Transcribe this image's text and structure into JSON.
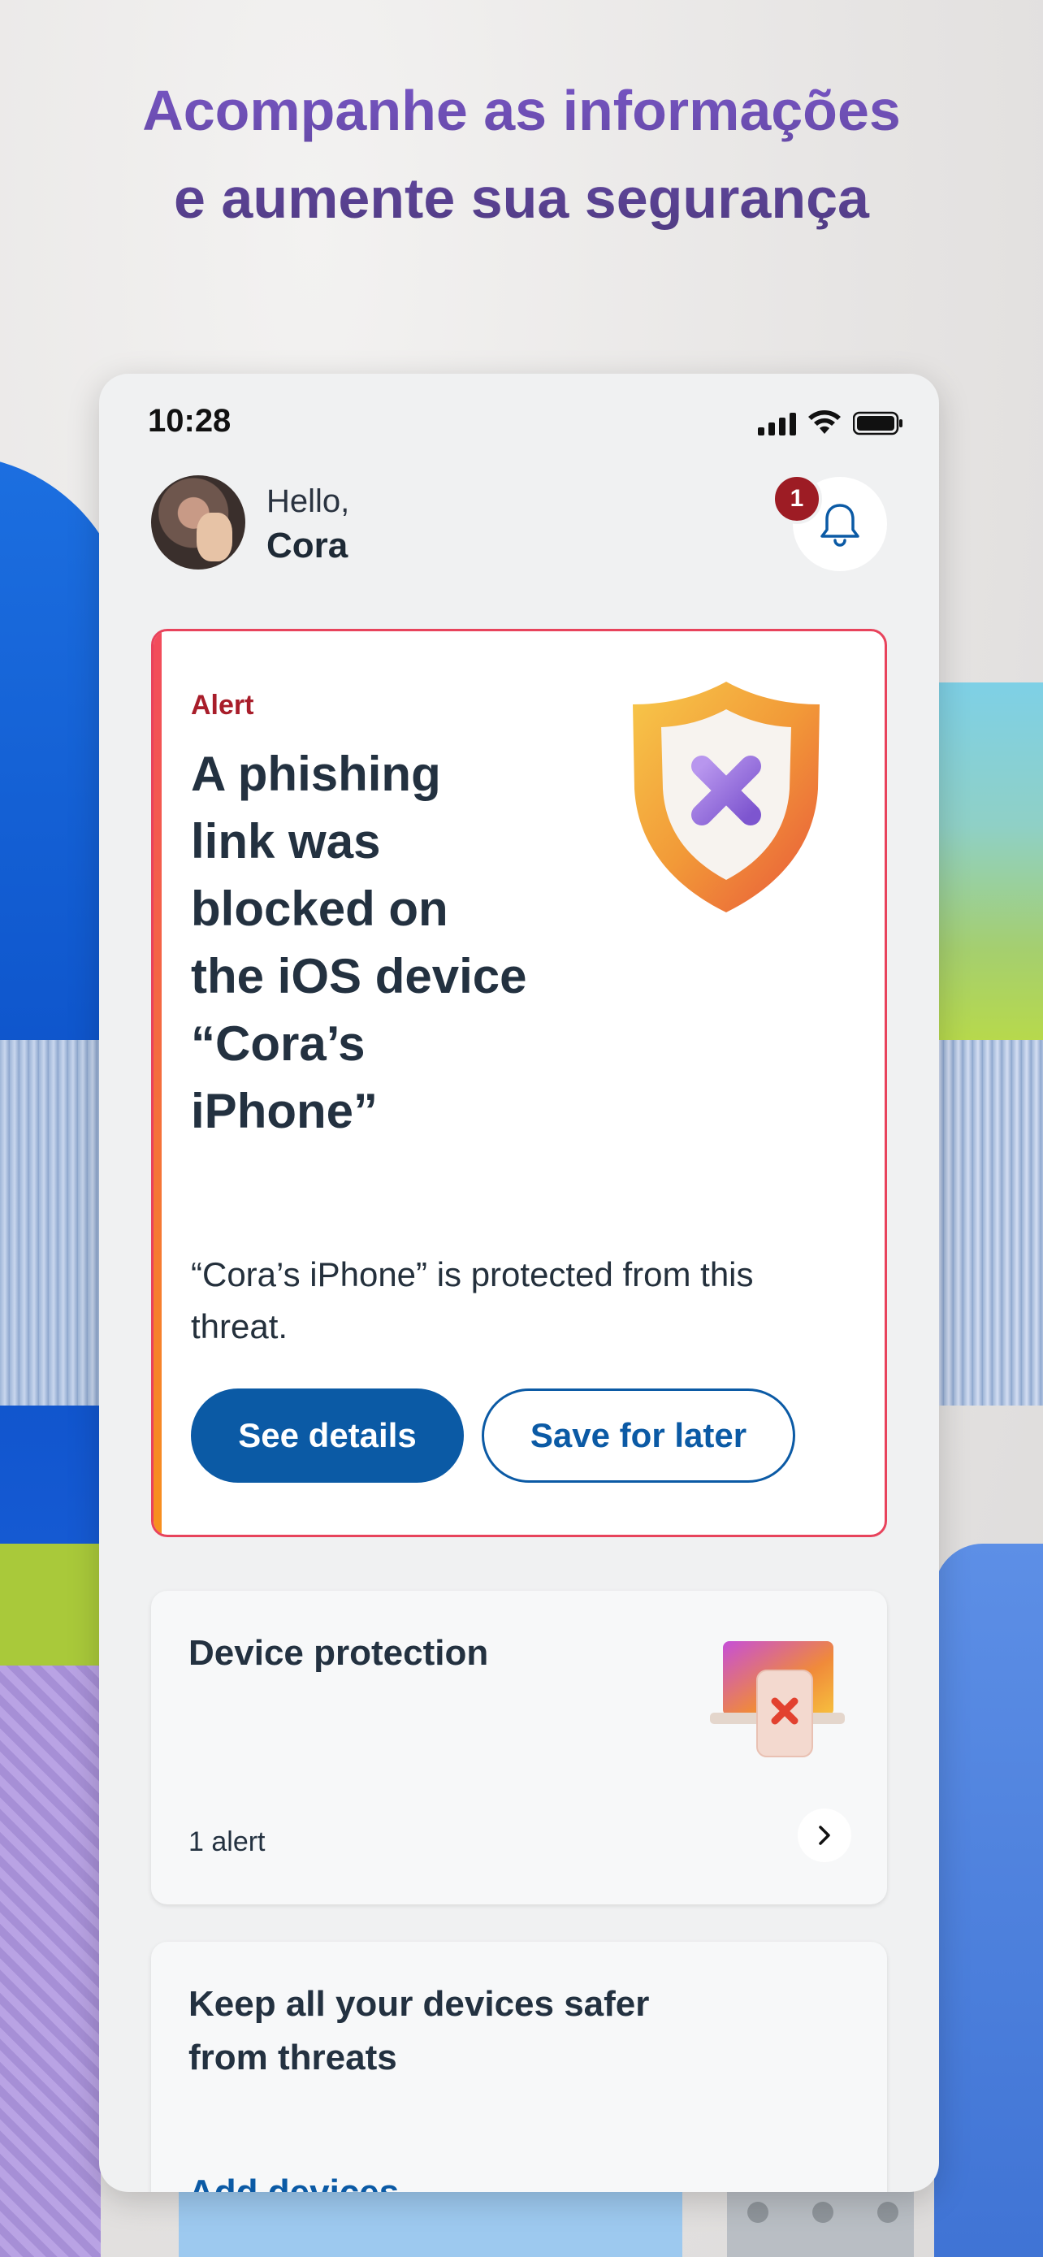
{
  "headline": {
    "line1": "Acompanhe as informações",
    "line2": "e aumente sua segurança"
  },
  "status_bar": {
    "time": "10:28",
    "icons": [
      "cellular-signal-icon",
      "wifi-icon",
      "battery-icon"
    ]
  },
  "header": {
    "greeting": "Hello,",
    "user_name": "Cora",
    "notification_count": "1"
  },
  "alert_card": {
    "label": "Alert",
    "title": "A phishing link was blocked on the iOS device “Cora’s iPhone”",
    "description": "“Cora’s iPhone” is protected from this threat.",
    "primary_button": "See details",
    "secondary_button": "Save for later",
    "icon": "shield-x-icon"
  },
  "device_card": {
    "title": "Device protection",
    "subtitle": "1 alert",
    "icon": "laptop-phone-x-icon"
  },
  "keep_card": {
    "title": "Keep all your devices safer from threats",
    "link": "Add devices"
  },
  "colors": {
    "headline_purple": "#6e52b8",
    "alert_red": "#a81d2a",
    "primary_blue": "#0b5aa5",
    "text_dark": "#233140",
    "badge_red": "#9d1c24"
  }
}
